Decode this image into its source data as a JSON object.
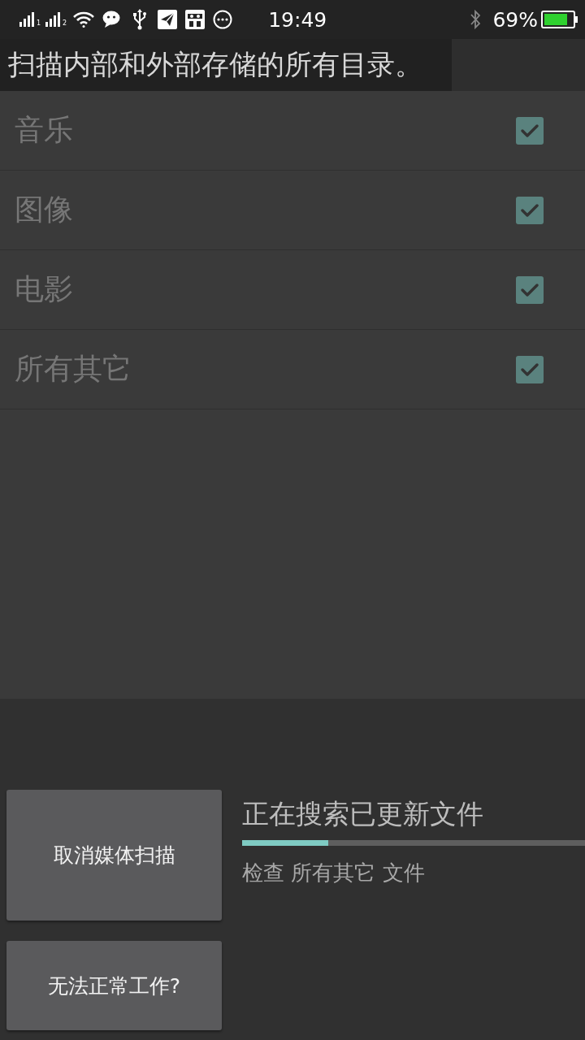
{
  "status_bar": {
    "sim_labels": [
      "1",
      "2"
    ],
    "time": "19:49",
    "battery": "69%"
  },
  "header": {
    "title": "扫描内部和外部存储的所有目录。"
  },
  "categories": [
    {
      "label": "音乐",
      "checked": true,
      "disabled": true
    },
    {
      "label": "图像",
      "checked": true,
      "disabled": true
    },
    {
      "label": "电影",
      "checked": true,
      "disabled": true
    },
    {
      "label": "所有其它",
      "checked": true,
      "disabled": true
    }
  ],
  "actions": [
    {
      "label": "取消媒体扫描"
    },
    {
      "label": "无法正常工作?"
    }
  ],
  "progress": {
    "title": "正在搜索已更新文件",
    "level": 0.25,
    "detail": "检查 所有其它 文件"
  }
}
